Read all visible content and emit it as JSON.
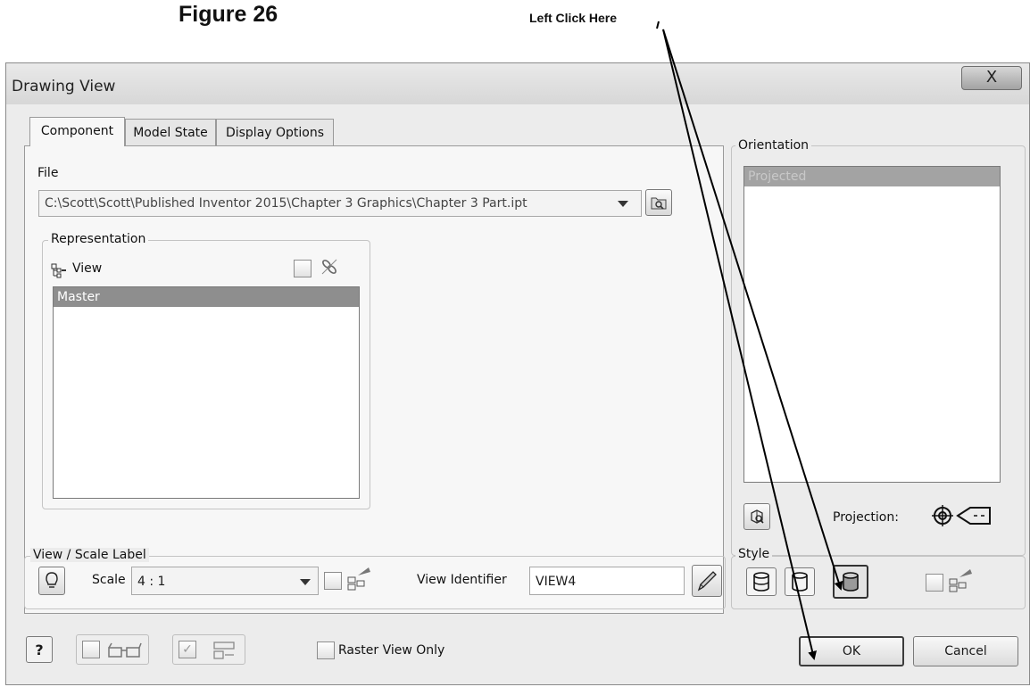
{
  "figure": {
    "title": "Figure 26",
    "callout": "Left Click Here"
  },
  "dialog": {
    "title": "Drawing View",
    "close_label": "X",
    "tabs": [
      {
        "label": "Component",
        "active": true
      },
      {
        "label": "Model State",
        "active": false
      },
      {
        "label": "Display Options",
        "active": false
      }
    ],
    "file": {
      "label": "File",
      "value": "C:\\Scott\\Scott\\Published Inventor 2015\\Chapter 3 Graphics\\Chapter 3 Part.ipt"
    },
    "representation": {
      "title": "Representation",
      "view_label": "View",
      "items": [
        "Master"
      ],
      "selected": "Master"
    },
    "orientation": {
      "title": "Orientation",
      "items": [
        "Projected"
      ],
      "selected": "Projected"
    },
    "projection_label": "Projection:",
    "view_scale": {
      "title": "View / Scale Label",
      "scale_label": "Scale",
      "scale_value": "4 : 1",
      "identifier_label": "View Identifier",
      "identifier_value": "VIEW4"
    },
    "style": {
      "title": "Style"
    },
    "footer": {
      "raster_label": "Raster View Only",
      "help_label": "?",
      "ok_label": "OK",
      "cancel_label": "Cancel"
    }
  },
  "colors": {
    "dialog_bg": "#ececec",
    "panel_bg": "#f7f7f7",
    "selection": "#8e8e8e",
    "arrow": "#000000"
  }
}
